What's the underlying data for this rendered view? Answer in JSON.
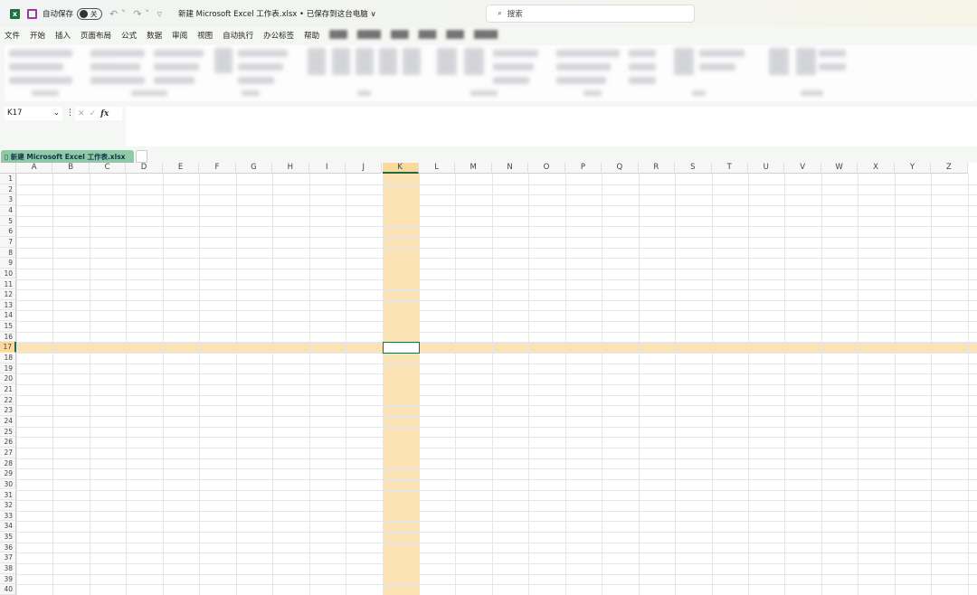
{
  "title_bar": {
    "autosave_label": "自动保存",
    "autosave_state": "关",
    "doc_title": "新建 Microsoft Excel 工作表.xlsx • 已保存到这台电脑 ∨",
    "search_placeholder": "搜索"
  },
  "menu": [
    "文件",
    "开始",
    "插入",
    "页面布局",
    "公式",
    "数据",
    "审阅",
    "视图",
    "自动执行",
    "办公标签",
    "帮助"
  ],
  "menu_blurred": [
    "▓▓▓",
    "▓▓▓▓",
    "▓▓▓",
    "▓▓▓",
    "▓▓▓",
    "▓▓▓▓"
  ],
  "formula_bar": {
    "name_box": "K17",
    "fx": "fx",
    "value": ""
  },
  "sheet_tab": {
    "label": "新建 Microsoft Excel 工作表.xlsx",
    "icon": "workbook-icon"
  },
  "grid": {
    "columns": [
      "A",
      "B",
      "C",
      "D",
      "E",
      "F",
      "G",
      "H",
      "I",
      "J",
      "K",
      "L",
      "M",
      "N",
      "O",
      "P",
      "Q",
      "R",
      "S",
      "T",
      "U",
      "V",
      "W",
      "X",
      "Y",
      "Z"
    ],
    "row_count": 40,
    "active_cell": "K17",
    "active_column": "K",
    "active_row": 17
  },
  "colors": {
    "highlight": "#fbe3b6",
    "selection_border": "#1d6b3e",
    "excel_green": "#1d7145"
  }
}
